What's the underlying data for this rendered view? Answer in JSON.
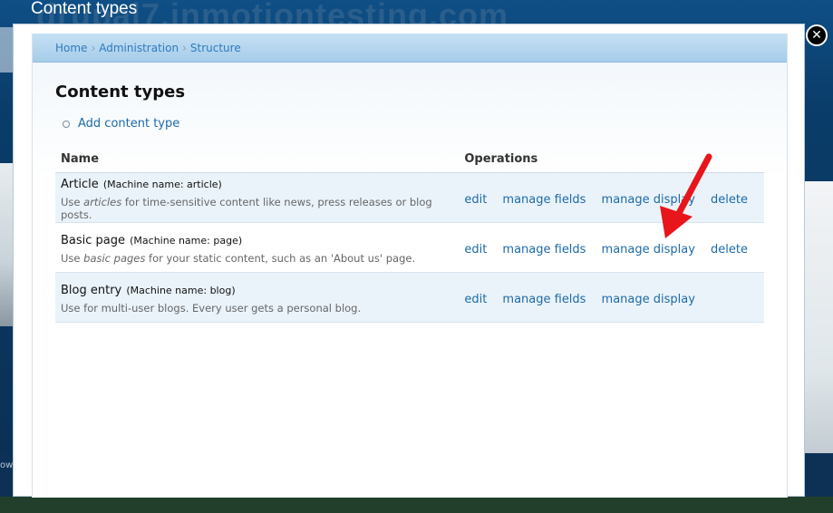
{
  "background": {
    "header_text": "drupal7.inmotiontesting.com",
    "footer_text": "ow"
  },
  "overlay": {
    "title": "Content types",
    "close_icon": "close-icon"
  },
  "breadcrumb": [
    {
      "label": "Home"
    },
    {
      "label": "Administration"
    },
    {
      "label": "Structure"
    }
  ],
  "page": {
    "title": "Content types",
    "add_link": "Add content type"
  },
  "table": {
    "headers": [
      "Name",
      "Operations"
    ],
    "rows": [
      {
        "name": "Article",
        "machine": "(Machine name: article)",
        "desc_pre": "Use ",
        "desc_em": "articles",
        "desc_post": " for time-sensitive content like news, press releases or blog posts.",
        "ops": [
          "edit",
          "manage fields",
          "manage display",
          "delete"
        ]
      },
      {
        "name": "Basic page",
        "machine": "(Machine name: page)",
        "desc_pre": "Use ",
        "desc_em": "basic pages",
        "desc_post": " for your static content, such as an 'About us' page.",
        "ops": [
          "edit",
          "manage fields",
          "manage display",
          "delete"
        ]
      },
      {
        "name": "Blog entry",
        "machine": "(Machine name: blog)",
        "desc_pre": "Use for multi-user blogs. Every user gets a personal blog.",
        "desc_em": "",
        "desc_post": "",
        "ops": [
          "edit",
          "manage fields",
          "manage display"
        ]
      }
    ]
  },
  "annotation": {
    "arrow_color": "#e8151b",
    "arrow_icon": "arrow-annotation"
  }
}
